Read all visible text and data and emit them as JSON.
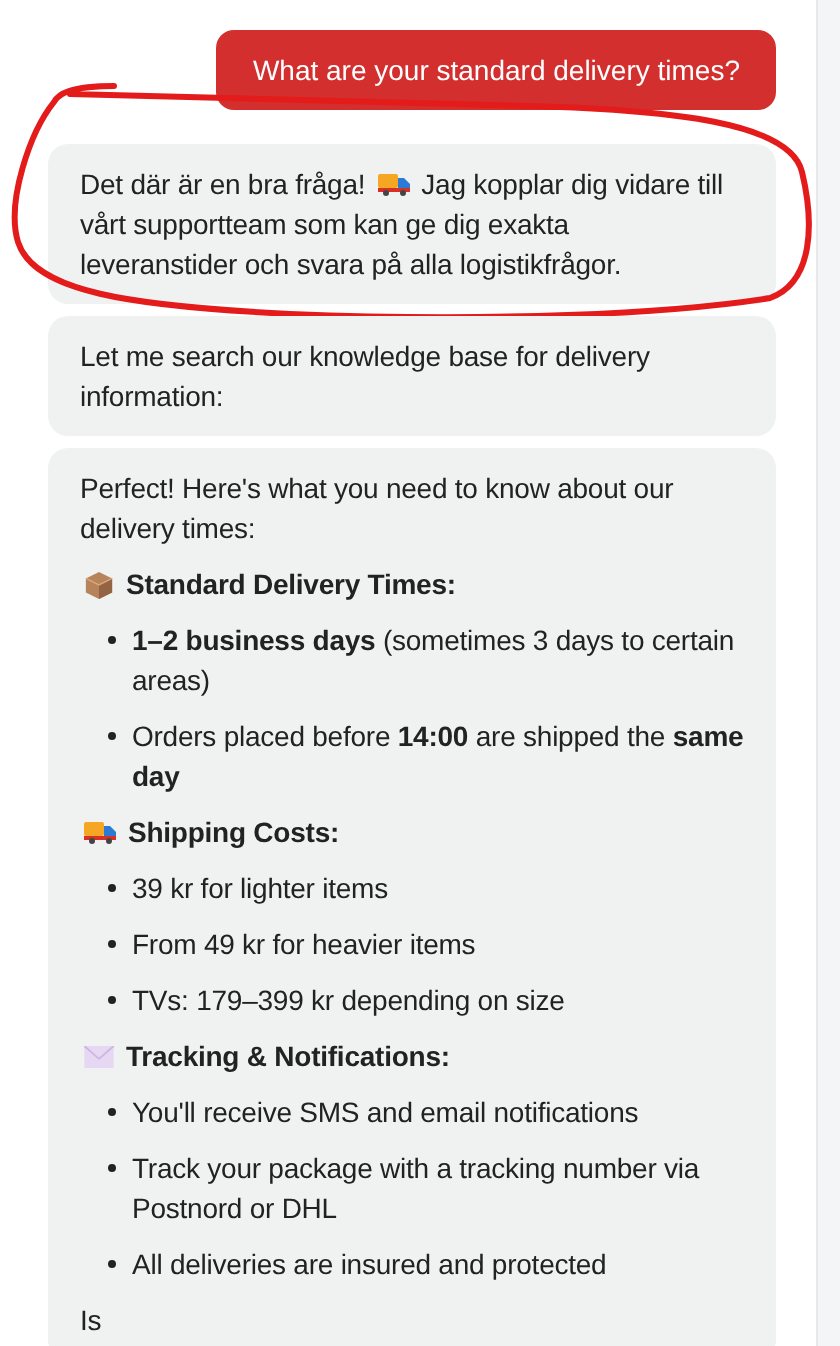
{
  "messages": [
    {
      "kind": "user",
      "text": "What are your standard delivery times?"
    },
    {
      "kind": "bot",
      "circled": true,
      "blocks": [
        {
          "kind": "lines",
          "lines": [
            [
              {
                "kind": "text",
                "text": "Det där är en bra fråga!"
              },
              {
                "kind": "icon"
              },
              {
                "kind": "text",
                "text": "Jag kopplar dig vidare till"
              }
            ],
            [
              {
                "kind": "text",
                "text": "vårt supportteam som kan ge dig exakta"
              }
            ],
            [
              {
                "kind": "text",
                "text": "leveranstider och svara på alla logistikfrågor."
              }
            ]
          ]
        }
      ]
    },
    {
      "kind": "bot",
      "circled": false,
      "blocks": [
        {
          "kind": "paragraph",
          "text": "Let me search our knowledge base for delivery information:"
        }
      ]
    },
    {
      "kind": "bot",
      "circled": false,
      "blocks": [
        {
          "kind": "paragraph",
          "text": "Perfect! Here's what you need to know about our delivery times:"
        },
        {
          "kind": "heading",
          "text": "Standard Delivery Times:"
        },
        {
          "kind": "list",
          "items": [
            "**1–2 business days** (sometimes 3 days to certain areas)",
            "Orders placed before **14:00** are shipped the **same day**"
          ]
        },
        {
          "kind": "heading",
          "text": "Shipping Costs:"
        },
        {
          "kind": "list",
          "items": [
            "39 kr for lighter items",
            "From 49 kr for heavier items",
            "TVs: 179–399 kr depending on size"
          ]
        },
        {
          "kind": "heading",
          "text": "Tracking & Notifications:"
        },
        {
          "kind": "list",
          "items": [
            "You'll receive SMS and email notifications",
            "Track your package with a tracking number via Postnord or DHL",
            "All deliveries are insured and protected"
          ]
        },
        {
          "kind": "paragraph",
          "text": "Is"
        }
      ]
    }
  ]
}
